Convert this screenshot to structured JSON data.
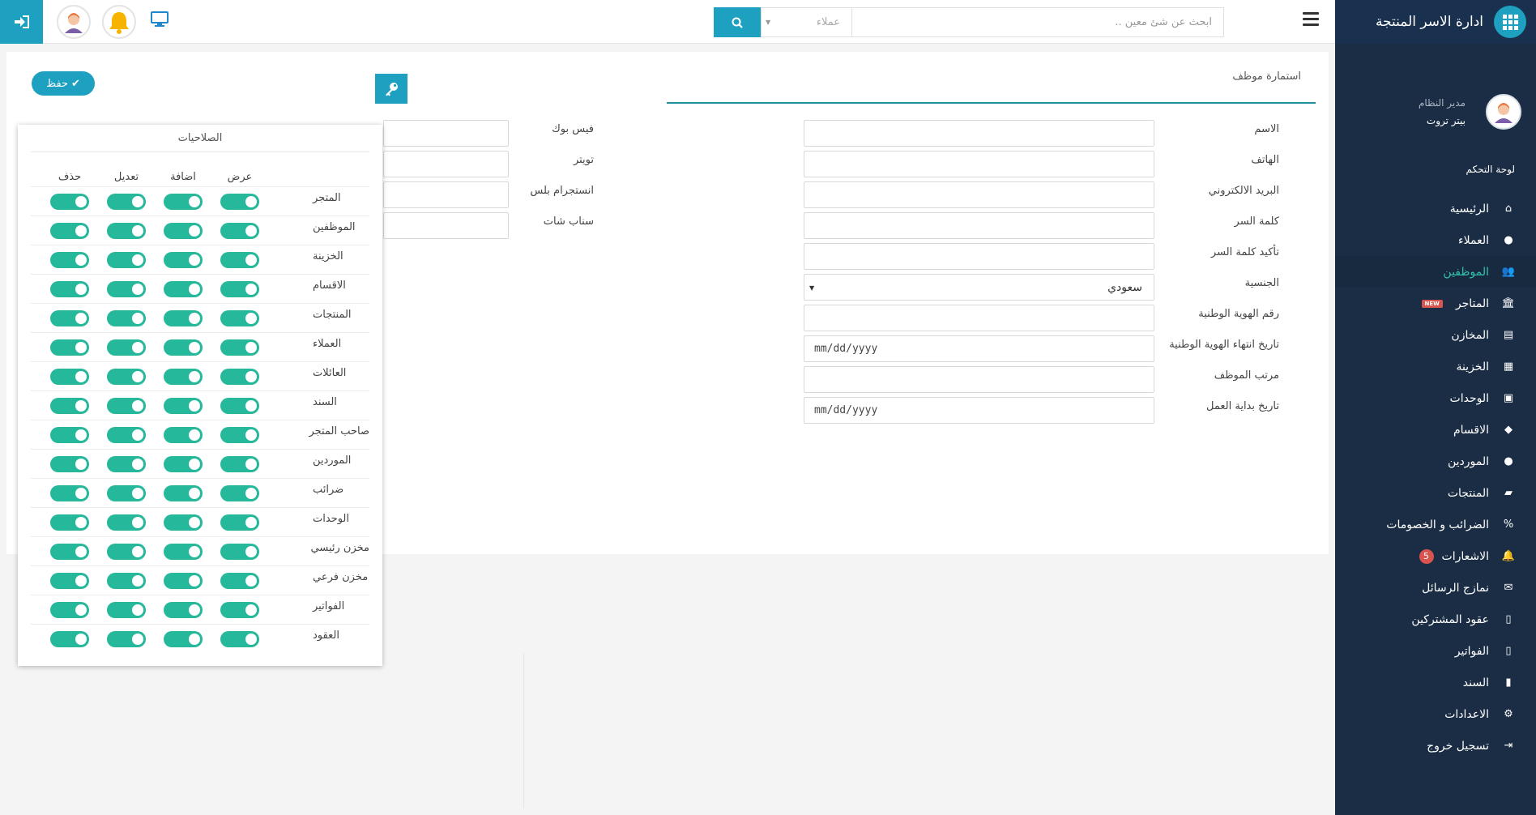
{
  "sidebar": {
    "app_title": "ادارة الاسر المنتجة",
    "user": {
      "role": "مدير النظام",
      "name": "بيتر تروت"
    },
    "section_title": "لوحة التحكم",
    "items": [
      {
        "label": "الرئيسية",
        "icon": "home-icon",
        "glyph": "⌂"
      },
      {
        "label": "العملاء",
        "icon": "user-icon",
        "glyph": "●"
      },
      {
        "label": "الموظفين",
        "icon": "users-icon",
        "glyph": "👥",
        "active": true
      },
      {
        "label": "المتاجر",
        "icon": "bank-icon",
        "glyph": "🏛",
        "badge": "NEW"
      },
      {
        "label": "المخازن",
        "icon": "store-icon",
        "glyph": "▤"
      },
      {
        "label": "الخزينة",
        "icon": "cash-register-icon",
        "glyph": "▦"
      },
      {
        "label": "الوحدات",
        "icon": "box-icon",
        "glyph": "▣"
      },
      {
        "label": "الاقسام",
        "icon": "tags-icon",
        "glyph": "◆"
      },
      {
        "label": "الموردين",
        "icon": "user-icon",
        "glyph": "●"
      },
      {
        "label": "المنتجات",
        "icon": "bag-icon",
        "glyph": "▰"
      },
      {
        "label": "الضرائب و الخصومات",
        "icon": "percent-icon",
        "glyph": "%"
      },
      {
        "label": "الاشعارات",
        "icon": "bell-icon",
        "glyph": "🔔",
        "count": "5"
      },
      {
        "label": "نمازج الرسائل",
        "icon": "envelope-icon",
        "glyph": "✉"
      },
      {
        "label": "عقود المشتركين",
        "icon": "file-icon",
        "glyph": "▯"
      },
      {
        "label": "الفواتير",
        "icon": "file-text-icon",
        "glyph": "▯"
      },
      {
        "label": "السند",
        "icon": "book-icon",
        "glyph": "▮"
      },
      {
        "label": "الاعدادات",
        "icon": "cogs-icon",
        "glyph": "⚙"
      },
      {
        "label": "تسجيل خروج",
        "icon": "sign-out-icon",
        "glyph": "⇥"
      }
    ]
  },
  "topbar": {
    "search_placeholder": "ابحث عن شئ معين ..",
    "search_scope": "عملاء"
  },
  "form": {
    "title": "استمارة موظف",
    "save_label": "حفظ",
    "fields": [
      {
        "label": "الاسم",
        "value": ""
      },
      {
        "label": "الهاتف",
        "value": ""
      },
      {
        "label": "البريد الالكتروني",
        "value": ""
      },
      {
        "label": "كلمة السر",
        "value": ""
      },
      {
        "label": "تأكيد كلمة السر",
        "value": ""
      },
      {
        "label": "الجنسية",
        "value": "سعودي"
      },
      {
        "label": "رقم الهوية الوطنية",
        "value": ""
      },
      {
        "label": "تاريخ انتهاء الهوية الوطنية",
        "value": "mm/dd/yyyy"
      },
      {
        "label": "مرتب الموظف",
        "value": ""
      },
      {
        "label": "تاريخ بداية العمل",
        "value": "mm/dd/yyyy"
      }
    ],
    "social": [
      {
        "label": "فيس بوك",
        "value": ""
      },
      {
        "label": "تويتر",
        "value": ""
      },
      {
        "label": "انستجرام بلس",
        "value": ""
      },
      {
        "label": "سناب شات",
        "value": ""
      }
    ]
  },
  "permissions": {
    "title": "الصلاحيات",
    "columns": [
      "عرض",
      "اضافة",
      "تعديل",
      "حذف"
    ],
    "rows": [
      {
        "label": "المتجر",
        "values": [
          true,
          true,
          true,
          true
        ]
      },
      {
        "label": "الموظفين",
        "values": [
          true,
          true,
          true,
          true
        ]
      },
      {
        "label": "الخزينة",
        "values": [
          true,
          true,
          true,
          true
        ]
      },
      {
        "label": "الاقسام",
        "values": [
          true,
          true,
          true,
          true
        ]
      },
      {
        "label": "المنتجات",
        "values": [
          true,
          true,
          true,
          true
        ]
      },
      {
        "label": "العملاء",
        "values": [
          true,
          true,
          true,
          true
        ]
      },
      {
        "label": "العائلات",
        "values": [
          true,
          true,
          true,
          true
        ]
      },
      {
        "label": "السند",
        "values": [
          true,
          true,
          true,
          true
        ]
      },
      {
        "label": "صاحب المتجر",
        "values": [
          true,
          true,
          true,
          true
        ]
      },
      {
        "label": "الموردين",
        "values": [
          true,
          true,
          true,
          true
        ]
      },
      {
        "label": "ضرائب",
        "values": [
          true,
          true,
          true,
          true
        ]
      },
      {
        "label": "الوحدات",
        "values": [
          true,
          true,
          true,
          true
        ]
      },
      {
        "label": "مخزن رئيسي",
        "values": [
          true,
          true,
          true,
          true
        ]
      },
      {
        "label": "مخزن فرعي",
        "values": [
          true,
          true,
          true,
          true
        ]
      },
      {
        "label": "الفواتير",
        "values": [
          true,
          true,
          true,
          true
        ]
      },
      {
        "label": "العقود",
        "values": [
          true,
          true,
          true,
          true
        ]
      }
    ]
  },
  "colors": {
    "accent": "#1ea0c0",
    "sidebar": "#1b2d45",
    "active_text": "#32c3a9",
    "toggle_on": "#26b89a",
    "badge": "#d9534f"
  }
}
